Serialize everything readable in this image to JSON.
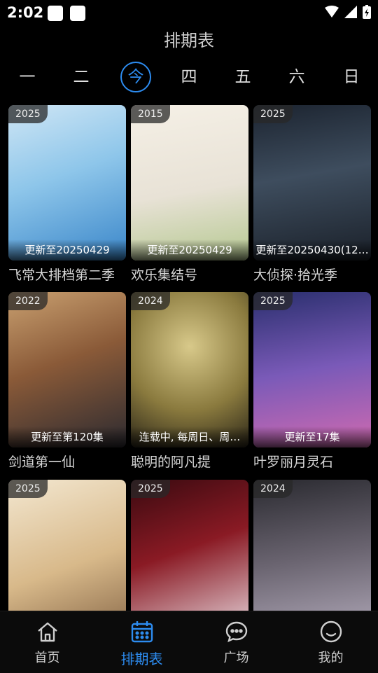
{
  "status": {
    "time": "2:02"
  },
  "header": {
    "title": "排期表"
  },
  "weekdays": {
    "days": [
      "一",
      "二",
      "今",
      "四",
      "五",
      "六",
      "日"
    ],
    "active_index": 2
  },
  "items": [
    {
      "year": "2025",
      "update": "更新至20250429",
      "title": "飞常大排档第二季"
    },
    {
      "year": "2015",
      "update": "更新至20250429",
      "title": "欢乐集结号"
    },
    {
      "year": "2025",
      "update": "更新至20250430(12…",
      "title": "大侦探·拾光季"
    },
    {
      "year": "2022",
      "update": "更新至第120集",
      "title": "剑道第一仙"
    },
    {
      "year": "2024",
      "update": "连载中, 每周日、周…",
      "title": "聪明的阿凡提"
    },
    {
      "year": "2025",
      "update": "更新至17集",
      "title": "叶罗丽月灵石"
    },
    {
      "year": "2025",
      "update": "",
      "title": ""
    },
    {
      "year": "2025",
      "update": "",
      "title": ""
    },
    {
      "year": "2024",
      "update": "",
      "title": ""
    }
  ],
  "tabbar": {
    "tabs": [
      {
        "label": "首页",
        "icon": "home-icon"
      },
      {
        "label": "排期表",
        "icon": "calendar-icon"
      },
      {
        "label": "广场",
        "icon": "chat-icon"
      },
      {
        "label": "我的",
        "icon": "smile-icon"
      }
    ],
    "active_index": 1
  },
  "colors": {
    "accent": "#2d8cf0",
    "background": "#000000"
  }
}
